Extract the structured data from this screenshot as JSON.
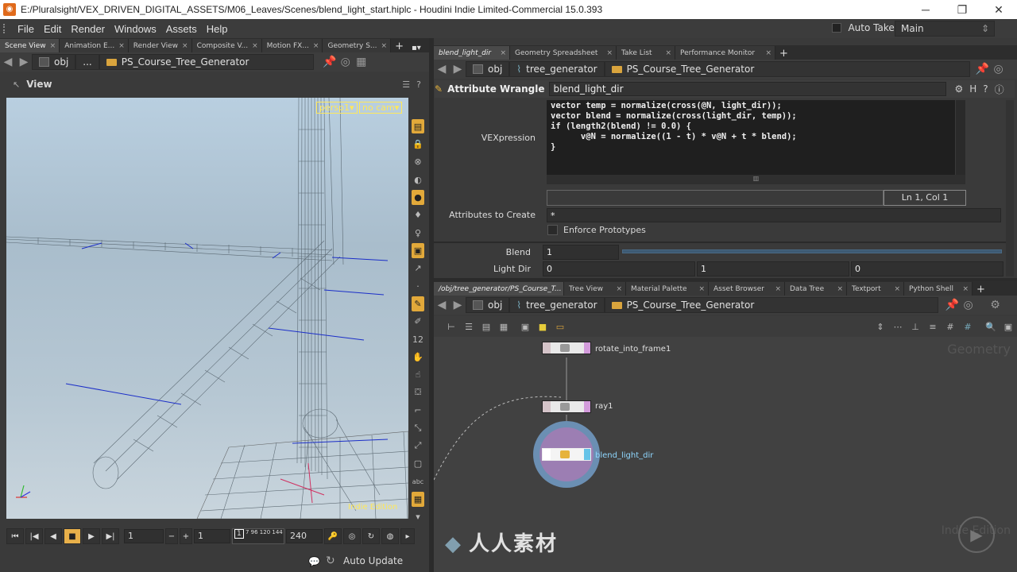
{
  "window": {
    "title": "E:/Pluralsight/VEX_DRIVEN_DIGITAL_ASSETS/M06_Leaves/Scenes/blend_light_start.hiplc - Houdini Indie Limited-Commercial 15.0.393",
    "minimize": "─",
    "maximize": "❐",
    "close": "✕"
  },
  "menu": {
    "items": [
      "File",
      "Edit",
      "Render",
      "Windows",
      "Assets",
      "Help"
    ],
    "auto_takes": "Auto Takes",
    "desktop": "Main"
  },
  "left_panel": {
    "tabs": [
      "Scene View",
      "Animation E...",
      "Render View",
      "Composite V...",
      "Motion FX...",
      "Geometry S..."
    ],
    "path_obj": "obj",
    "path_ellipsis": "...",
    "path_node": "PS_Course_Tree_Generator",
    "view_title": "View",
    "camera_persp": "persp1▾",
    "camera_nocam": "no cam▾",
    "indie_edition": "Indie Edition"
  },
  "playbar": {
    "frame": "1",
    "start": "1",
    "timeline_label": "1",
    "timeline_ticks": "7 96 120 144",
    "end": "240",
    "auto_update": "Auto Update"
  },
  "param_panel": {
    "tabs": [
      "blend_light_dir",
      "Geometry Spreadsheet",
      "Take List",
      "Performance Monitor"
    ],
    "path_obj": "obj",
    "path_generator": "tree_generator",
    "path_node": "PS_Course_Tree_Generator",
    "node_type": "Attribute Wrangle",
    "node_name": "blend_light_dir",
    "vex_label": "VEXpression",
    "code_lines": [
      "vector temp = normalize(cross(@N, light_dir));",
      "vector blend = normalize(cross(light_dir, temp));",
      "",
      "if (length2(blend) != 0.0) {",
      "      v@N = normalize((1 - t) * v@N + t * blend);",
      "}"
    ],
    "cursor_pos": "Ln 1, Col 1",
    "attrs_label": "Attributes to Create",
    "attrs_value": "*",
    "enforce_label": "Enforce Prototypes",
    "blend_label": "Blend",
    "blend_value": "1",
    "blend_fraction": 1.0,
    "lightdir_label": "Light Dir",
    "lightdir_values": [
      "0",
      "1",
      "0"
    ]
  },
  "network_panel": {
    "tabs": [
      "/obj/tree_generator/PS_Course_T...",
      "Tree View",
      "Material Palette",
      "Asset Browser",
      "Data Tree",
      "Textport",
      "Python Shell"
    ],
    "path_obj": "obj",
    "path_generator": "tree_generator",
    "path_node": "PS_Course_Tree_Generator",
    "context_label": "Geometry",
    "indie_label": "Indie Edition",
    "nodes": [
      {
        "name": "rotate_into_frame1"
      },
      {
        "name": "ray1"
      },
      {
        "name": "blend_light_dir"
      }
    ]
  },
  "watermark": "人人素材"
}
